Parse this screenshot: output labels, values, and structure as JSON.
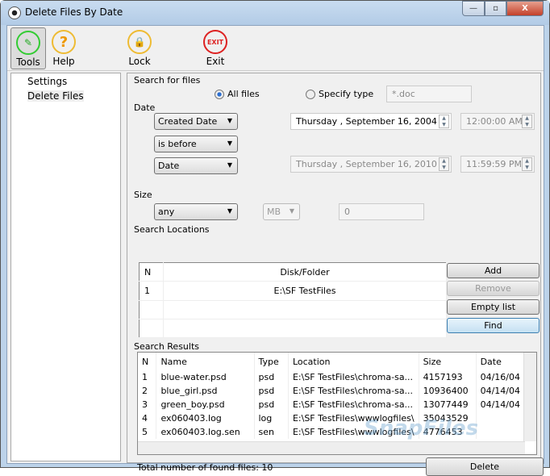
{
  "window": {
    "title": "Delete Files By Date",
    "min": "—",
    "max": "▫",
    "close": "X"
  },
  "toolbar": {
    "tools": "Tools",
    "help": "Help",
    "lock": "Lock",
    "exit": "Exit",
    "exit_icon": "EXIT",
    "help_icon": "?"
  },
  "tree": {
    "items": [
      "Settings",
      "Delete Files"
    ]
  },
  "search": {
    "section": "Search for files",
    "all_files": "All files",
    "specify_type": "Specify type",
    "type_value": "*.doc"
  },
  "date": {
    "section": "Date",
    "field": "Created Date",
    "condition": "is before",
    "mode": "Date",
    "date1": "Thursday  , September 16, 2004",
    "time1": "12:00:00 AM",
    "date2": "Thursday  , September 16, 2010",
    "time2": "11:59:59 PM"
  },
  "size": {
    "section": "Size",
    "op": "any",
    "unit": "MB",
    "value": "0"
  },
  "locations": {
    "section": "Search Locations",
    "columns": [
      "N",
      "Disk/Folder"
    ],
    "rows": [
      [
        "1",
        "E:\\SF TestFiles"
      ]
    ],
    "add": "Add",
    "remove": "Remove",
    "empty": "Empty list",
    "find": "Find"
  },
  "results": {
    "section": "Search Results",
    "columns": [
      "N",
      "Name",
      "Type",
      "Location",
      "Size",
      "Date"
    ],
    "rows": [
      [
        "1",
        "blue-water.psd",
        "psd",
        "E:\\SF TestFiles\\chroma-sa...",
        "4157193",
        "04/16/04"
      ],
      [
        "2",
        "blue_girl.psd",
        "psd",
        "E:\\SF TestFiles\\chroma-sa...",
        "10936400",
        "04/14/04"
      ],
      [
        "3",
        "green_boy.psd",
        "psd",
        "E:\\SF TestFiles\\chroma-sa...",
        "13077449",
        "04/14/04"
      ],
      [
        "4",
        "ex060403.log",
        "log",
        "E:\\SF TestFiles\\wwwlogfiles\\",
        "35043529",
        ""
      ],
      [
        "5",
        "ex060403.log.sen",
        "sen",
        "E:\\SF TestFiles\\wwwlogfiles\\",
        "4776453",
        ""
      ]
    ],
    "total": "Total number of found files: 10",
    "delete": "Delete"
  },
  "watermark": "SnapFiles"
}
